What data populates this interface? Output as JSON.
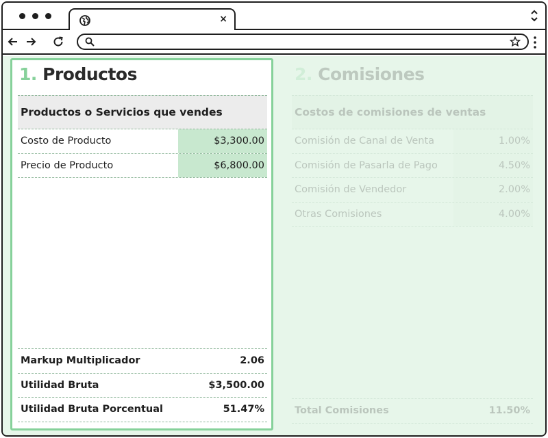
{
  "tab": {
    "close_glyph": "×"
  },
  "productos": {
    "number": "1.",
    "title": "Productos",
    "section_header": "Productos o Servicios que vendes",
    "rows": [
      {
        "label": "Costo de Producto",
        "value": "$3,300.00"
      },
      {
        "label": "Precio de Producto",
        "value": "$6,800.00"
      }
    ],
    "summary": [
      {
        "label": "Markup Multiplicador",
        "value": "2.06"
      },
      {
        "label": "Utilidad Bruta",
        "value": "$3,500.00"
      },
      {
        "label": "Utilidad Bruta Porcentual",
        "value": "51.47%"
      }
    ]
  },
  "comisiones": {
    "number": "2.",
    "title": "Comisiones",
    "section_header": "Costos de comisiones de ventas",
    "rows": [
      {
        "label": "Comisión de Canal de Venta",
        "value": "1.00%"
      },
      {
        "label": "Comisión de Pasarla de Pago",
        "value": "4.50%"
      },
      {
        "label": "Comisión de Vendedor",
        "value": "2.00%"
      },
      {
        "label": "Otras Comisiones",
        "value": "4.00%"
      }
    ],
    "total": {
      "label": "Total Comisiones",
      "value": "11.50%"
    }
  },
  "colors": {
    "accent": "#86d19a",
    "input_fill": "#c8e8cf",
    "background": "#e7f6ea"
  }
}
